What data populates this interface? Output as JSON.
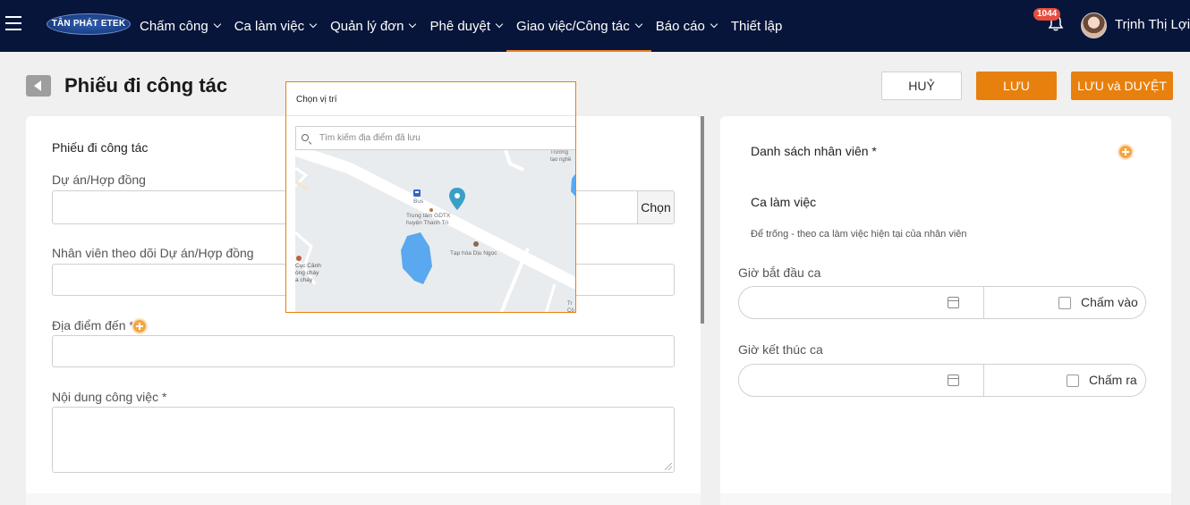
{
  "nav": {
    "logo": "TÂN PHÁT ETEK",
    "items": [
      {
        "label": "Chấm công",
        "dropdown": true
      },
      {
        "label": "Ca làm việc",
        "dropdown": true
      },
      {
        "label": "Quản lý đơn",
        "dropdown": true
      },
      {
        "label": "Phê duyệt",
        "dropdown": true
      },
      {
        "label": "Giao việc/Công tác",
        "dropdown": true,
        "active": true
      },
      {
        "label": "Báo cáo",
        "dropdown": true
      },
      {
        "label": "Thiết lập",
        "dropdown": false
      }
    ],
    "notification_count": "1044",
    "user_name": "Trịnh Thị Lợi",
    "accent_color": "#e67e22",
    "bg_color": "#07153a"
  },
  "header": {
    "title": "Phiếu đi công tác",
    "cancel_label": "HUỶ",
    "save_label": "LƯU",
    "save_approve_label": "LƯU và DUYỆT"
  },
  "form": {
    "section_title": "Phiếu đi công tác",
    "project_label": "Dự án/Hợp đồng",
    "choose_label": "Chọn",
    "follower_label": "Nhân viên theo dõi Dự án/Hợp đồng",
    "destination_label": "Địa điểm đến *",
    "content_label": "Nội dung công việc *"
  },
  "right": {
    "employee_list_title": "Danh sách nhân viên *",
    "shift_title": "Ca làm việc",
    "shift_hint": "Để trống - theo ca làm việc hiện tại của nhân viên",
    "start_label": "Giờ bắt đầu ca",
    "start_check_label": "Chấm vào",
    "end_label": "Giờ kết thúc ca",
    "end_check_label": "Chấm ra"
  },
  "popup": {
    "title": "Chọn vị trí",
    "search_placeholder": "Tìm kiếm địa điểm đã lưu",
    "map_labels": {
      "bus": "Bus",
      "center": "Trung tâm GDTX",
      "center2": "huyện Thanh Trì",
      "shop": "Tạp hóa Dịu Ngọc",
      "left1": "Cục Cảnh",
      "left2": "òng cháy",
      "left3": "a cháy",
      "top_right1": "Trường",
      "top_right2": "tạo nghề",
      "bottom_right1": "Tr",
      "bottom_right2": "Cô"
    }
  }
}
